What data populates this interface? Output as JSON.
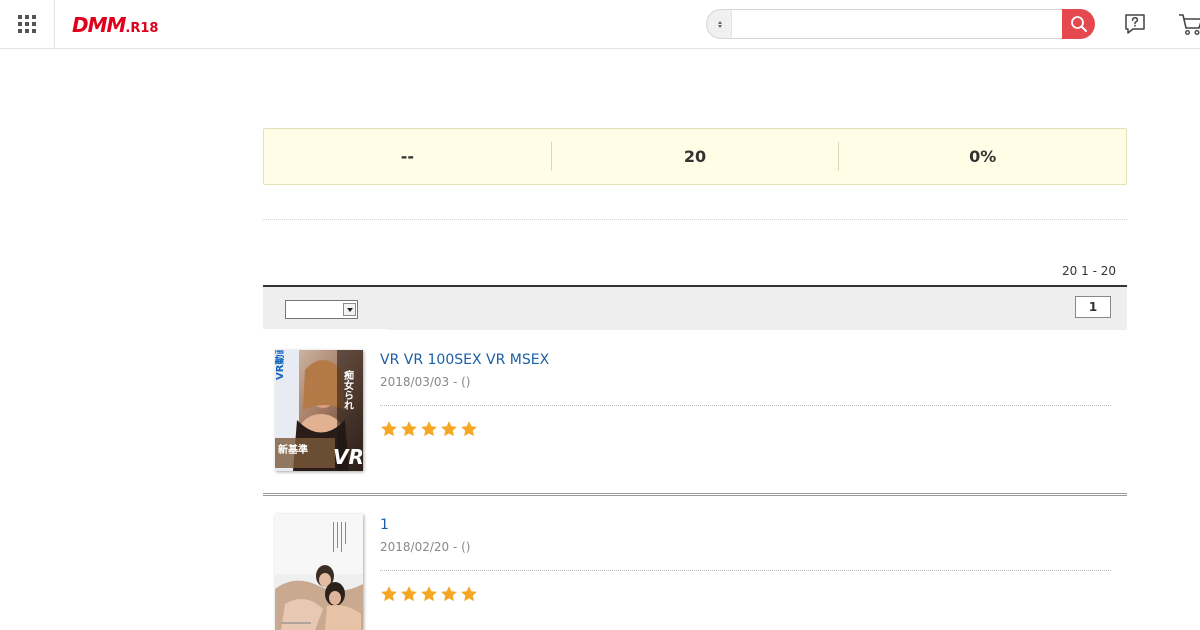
{
  "header": {
    "logo_main": "DMM",
    "logo_sub": ".R18",
    "search": {
      "placeholder": "",
      "value": ""
    },
    "accent_color": "#e5484d",
    "icons": [
      "apps-grid-icon",
      "select-updown-icon",
      "search-icon",
      "help-icon",
      "cart-icon"
    ]
  },
  "summary": {
    "cells": [
      "--",
      "20",
      "0%"
    ]
  },
  "list": {
    "count_text": "20 1 - 20",
    "sort_value": "",
    "current_page": "1",
    "star_color": "#f5a623"
  },
  "items": [
    {
      "title": "VR VR 100SEX VR  MSEX",
      "date": "2018/03/03 - ()",
      "rating": 5,
      "thumb_text": [
        "VR動画",
        "痴女られ",
        "新基準",
        "VR"
      ]
    },
    {
      "title": "1",
      "date": "2018/02/20 - ()",
      "rating": 5
    }
  ]
}
